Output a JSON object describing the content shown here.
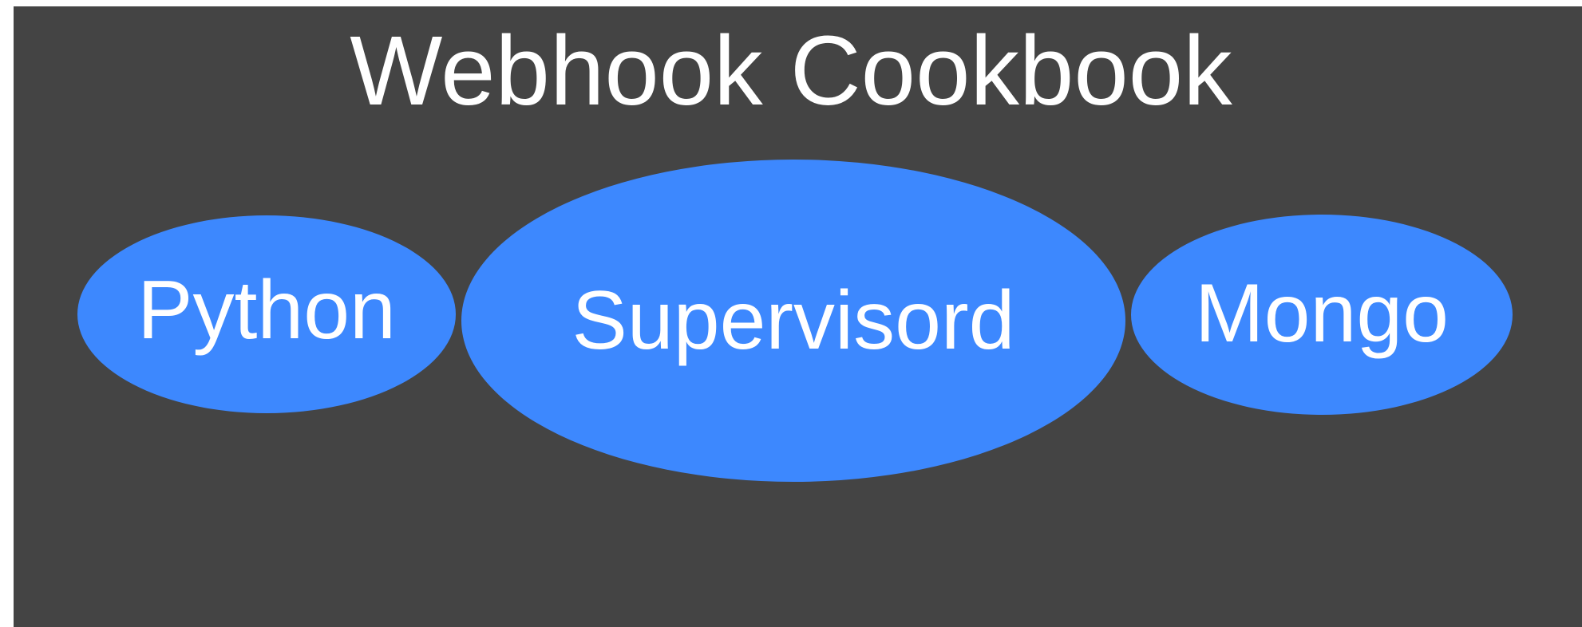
{
  "title": "Webhook Cookbook",
  "components": [
    {
      "label": "Python"
    },
    {
      "label": "Supervisord"
    },
    {
      "label": "Mongo"
    }
  ],
  "colors": {
    "background": "#444444",
    "bubble": "#3d88fe",
    "text": "#ffffff"
  }
}
